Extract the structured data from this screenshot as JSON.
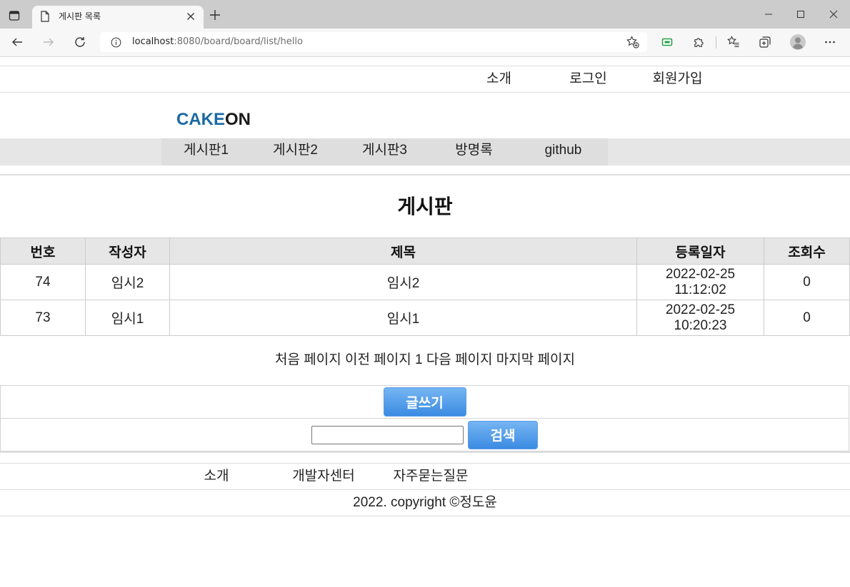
{
  "browser": {
    "tab_title": "게시판 목록",
    "url_host": "localhost",
    "url_rest": ":8080/board/board/list/hello",
    "toolbar_icons": [
      "tab-actions-icon",
      "page-icon",
      "close-tab-icon",
      "new-tab-icon",
      "minimize-icon",
      "maximize-icon",
      "close-window-icon",
      "back-icon",
      "forward-icon",
      "refresh-icon",
      "info-icon",
      "add-favorite-icon",
      "extension-icon",
      "extensions-puzzle-icon",
      "favorites-icon",
      "collections-icon",
      "profile-icon",
      "more-icon"
    ]
  },
  "top_nav": {
    "items": [
      "소개",
      "로그인",
      "회원가입"
    ]
  },
  "logo": {
    "part1": "CAKE",
    "part2": "ON"
  },
  "main_menu": {
    "items": [
      "게시판1",
      "게시판2",
      "게시판3",
      "방명록",
      "github"
    ]
  },
  "board": {
    "title": "게시판",
    "headers": {
      "no": "번호",
      "writer": "작성자",
      "subject": "제목",
      "reg_date": "등록일자",
      "views": "조회수"
    },
    "rows": [
      {
        "no": "74",
        "writer": "임시2",
        "subject": "임시2",
        "reg_date": "2022-02-25 11:12:02",
        "views": "0"
      },
      {
        "no": "73",
        "writer": "임시1",
        "subject": "임시1",
        "reg_date": "2022-02-25 10:20:23",
        "views": "0"
      }
    ]
  },
  "pagination": {
    "first": "처음 페이지",
    "prev": "이전 페이지",
    "current": "1",
    "next": "다음 페이지",
    "last": "마지막 페이지"
  },
  "actions": {
    "write_label": "글쓰기",
    "search_value": "",
    "search_label": "검색"
  },
  "footer": {
    "links": [
      "소개",
      "개발자센터",
      "자주묻는질문"
    ],
    "copyright": "2022. copyright ©정도윤"
  },
  "colors": {
    "logo_accent": "#1b6aa5",
    "logo_dark": "#1a1a1a",
    "button_top": "#76b5f3",
    "button_bottom": "#3b8be2",
    "nav_bg": "#e6e6e6",
    "nav_inner_bg": "#dedede",
    "header_bg": "#e6e6e6"
  }
}
